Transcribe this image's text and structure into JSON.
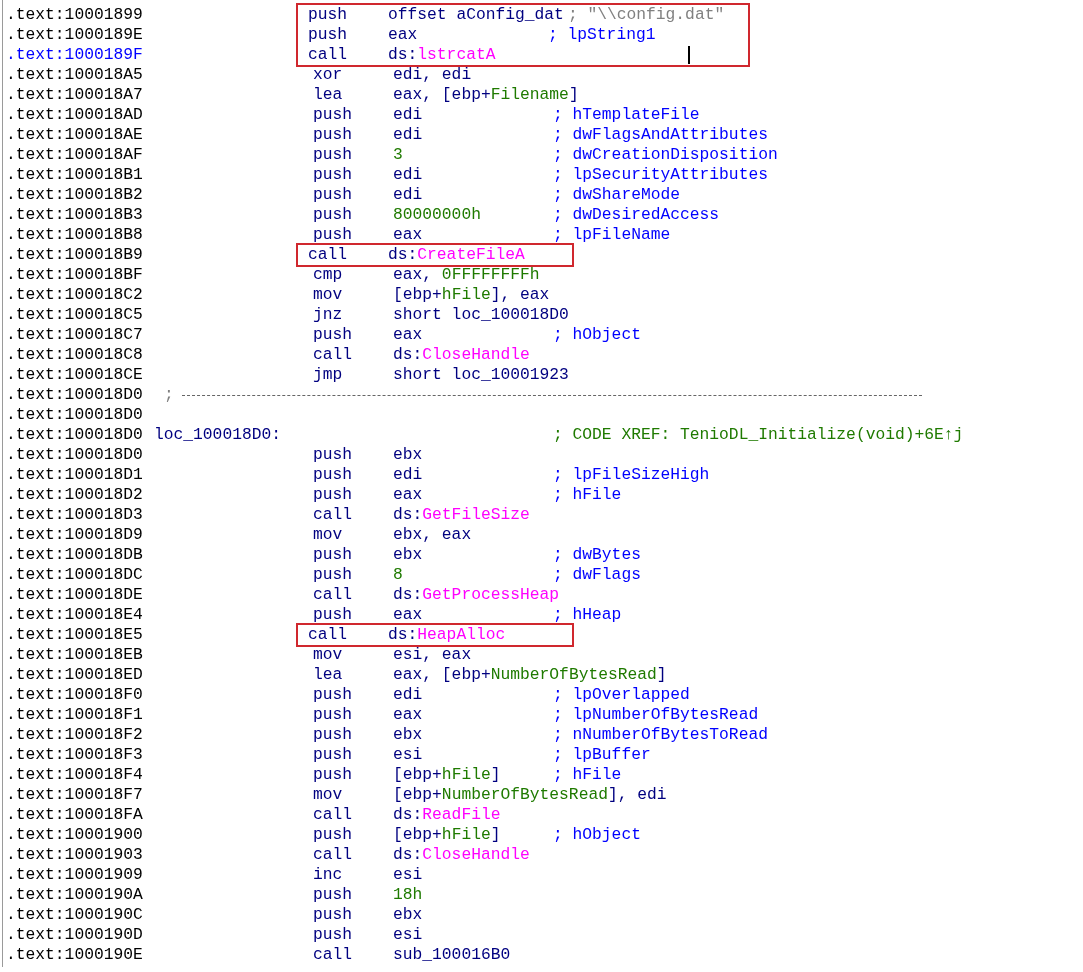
{
  "blocks": [
    {
      "kind": "highlight",
      "lines": [
        {
          "addr": ".text:10001899",
          "kind": "instr",
          "selected": false,
          "mnemonic": "push",
          "operands": [
            {
              "text": "offset aConfig_dat",
              "kind": "op"
            }
          ],
          "comment": {
            "text": "; \"\\\\config.dat\"",
            "kind": "str"
          }
        },
        {
          "addr": ".text:1000189E",
          "kind": "instr",
          "selected": false,
          "mnemonic": "push",
          "operands": [
            {
              "text": "eax",
              "kind": "op"
            }
          ],
          "comment": {
            "text": "; lpString1",
            "kind": "arg"
          }
        },
        {
          "addr": ".text:1000189F",
          "kind": "instr",
          "selected": true,
          "text_cursor": true,
          "mnemonic": "call",
          "operands": [
            {
              "text": "ds:",
              "kind": "op"
            },
            {
              "text": "lstrcatA",
              "kind": "api"
            }
          ]
        }
      ]
    },
    {
      "kind": "plain",
      "lines": [
        {
          "addr": ".text:100018A5",
          "kind": "instr",
          "selected": false,
          "mnemonic": "xor",
          "operands": [
            {
              "text": "edi, edi",
              "kind": "op"
            }
          ]
        },
        {
          "addr": ".text:100018A7",
          "kind": "instr",
          "selected": false,
          "mnemonic": "lea",
          "operands": [
            {
              "text": "eax, [ebp+",
              "kind": "op"
            },
            {
              "text": "Filename",
              "kind": "name"
            },
            {
              "text": "]",
              "kind": "op"
            }
          ]
        },
        {
          "addr": ".text:100018AD",
          "kind": "instr",
          "selected": false,
          "mnemonic": "push",
          "operands": [
            {
              "text": "edi",
              "kind": "op"
            }
          ],
          "comment": {
            "text": "; hTemplateFile",
            "kind": "arg"
          }
        },
        {
          "addr": ".text:100018AE",
          "kind": "instr",
          "selected": false,
          "mnemonic": "push",
          "operands": [
            {
              "text": "edi",
              "kind": "op"
            }
          ],
          "comment": {
            "text": "; dwFlagsAndAttributes",
            "kind": "arg"
          }
        },
        {
          "addr": ".text:100018AF",
          "kind": "instr",
          "selected": false,
          "mnemonic": "push",
          "operands": [
            {
              "text": "3",
              "kind": "num"
            }
          ],
          "comment": {
            "text": "; dwCreationDisposition",
            "kind": "arg"
          }
        },
        {
          "addr": ".text:100018B1",
          "kind": "instr",
          "selected": false,
          "mnemonic": "push",
          "operands": [
            {
              "text": "edi",
              "kind": "op"
            }
          ],
          "comment": {
            "text": "; lpSecurityAttributes",
            "kind": "arg"
          }
        },
        {
          "addr": ".text:100018B2",
          "kind": "instr",
          "selected": false,
          "mnemonic": "push",
          "operands": [
            {
              "text": "edi",
              "kind": "op"
            }
          ],
          "comment": {
            "text": "; dwShareMode",
            "kind": "arg"
          }
        },
        {
          "addr": ".text:100018B3",
          "kind": "instr",
          "selected": false,
          "mnemonic": "push",
          "operands": [
            {
              "text": "80000000h",
              "kind": "num"
            }
          ],
          "comment": {
            "text": "; dwDesiredAccess",
            "kind": "arg"
          }
        },
        {
          "addr": ".text:100018B8",
          "kind": "instr",
          "selected": false,
          "mnemonic": "push",
          "operands": [
            {
              "text": "eax",
              "kind": "op"
            }
          ],
          "comment": {
            "text": "; lpFileName",
            "kind": "arg"
          }
        }
      ]
    },
    {
      "kind": "highlight",
      "lines": [
        {
          "addr": ".text:100018B9",
          "kind": "instr",
          "selected": false,
          "mnemonic": "call",
          "operands": [
            {
              "text": "ds:",
              "kind": "op"
            },
            {
              "text": "CreateFileA",
              "kind": "api"
            }
          ]
        }
      ]
    },
    {
      "kind": "plain",
      "lines": [
        {
          "addr": ".text:100018BF",
          "kind": "instr",
          "selected": false,
          "mnemonic": "cmp",
          "operands": [
            {
              "text": "eax, ",
              "kind": "op"
            },
            {
              "text": "0FFFFFFFFh",
              "kind": "num"
            }
          ]
        },
        {
          "addr": ".text:100018C2",
          "kind": "instr",
          "selected": false,
          "mnemonic": "mov",
          "operands": [
            {
              "text": "[ebp+",
              "kind": "op"
            },
            {
              "text": "hFile",
              "kind": "name"
            },
            {
              "text": "], eax",
              "kind": "op"
            }
          ]
        },
        {
          "addr": ".text:100018C5",
          "kind": "instr",
          "selected": false,
          "mnemonic": "jnz",
          "operands": [
            {
              "text": "short loc_100018D0",
              "kind": "op"
            }
          ]
        },
        {
          "addr": ".text:100018C7",
          "kind": "instr",
          "selected": false,
          "mnemonic": "push",
          "operands": [
            {
              "text": "eax",
              "kind": "op"
            }
          ],
          "comment": {
            "text": "; hObject",
            "kind": "arg"
          }
        },
        {
          "addr": ".text:100018C8",
          "kind": "instr",
          "selected": false,
          "mnemonic": "call",
          "operands": [
            {
              "text": "ds:",
              "kind": "op"
            },
            {
              "text": "CloseHandle",
              "kind": "api"
            }
          ]
        },
        {
          "addr": ".text:100018CE",
          "kind": "instr",
          "selected": false,
          "mnemonic": "jmp",
          "operands": [
            {
              "text": "short loc_10001923",
              "kind": "op"
            }
          ]
        },
        {
          "addr": ".text:100018D0",
          "kind": "separator",
          "selected": false,
          "comment": {
            "text": ";",
            "kind": "sep"
          }
        },
        {
          "addr": ".text:100018D0",
          "kind": "blank",
          "selected": false
        },
        {
          "addr": ".text:100018D0",
          "kind": "label",
          "selected": false,
          "label": "loc_100018D0:",
          "comment": {
            "text": "; CODE XREF: TenioDL_Initialize(void)+6E↑j",
            "kind": "xref"
          }
        },
        {
          "addr": ".text:100018D0",
          "kind": "instr",
          "selected": false,
          "mnemonic": "push",
          "operands": [
            {
              "text": "ebx",
              "kind": "op"
            }
          ]
        },
        {
          "addr": ".text:100018D1",
          "kind": "instr",
          "selected": false,
          "mnemonic": "push",
          "operands": [
            {
              "text": "edi",
              "kind": "op"
            }
          ],
          "comment": {
            "text": "; lpFileSizeHigh",
            "kind": "arg"
          }
        },
        {
          "addr": ".text:100018D2",
          "kind": "instr",
          "selected": false,
          "mnemonic": "push",
          "operands": [
            {
              "text": "eax",
              "kind": "op"
            }
          ],
          "comment": {
            "text": "; hFile",
            "kind": "arg"
          }
        },
        {
          "addr": ".text:100018D3",
          "kind": "instr",
          "selected": false,
          "mnemonic": "call",
          "operands": [
            {
              "text": "ds:",
              "kind": "op"
            },
            {
              "text": "GetFileSize",
              "kind": "api"
            }
          ]
        },
        {
          "addr": ".text:100018D9",
          "kind": "instr",
          "selected": false,
          "mnemonic": "mov",
          "operands": [
            {
              "text": "ebx, eax",
              "kind": "op"
            }
          ]
        },
        {
          "addr": ".text:100018DB",
          "kind": "instr",
          "selected": false,
          "mnemonic": "push",
          "operands": [
            {
              "text": "ebx",
              "kind": "op"
            }
          ],
          "comment": {
            "text": "; dwBytes",
            "kind": "arg"
          }
        },
        {
          "addr": ".text:100018DC",
          "kind": "instr",
          "selected": false,
          "mnemonic": "push",
          "operands": [
            {
              "text": "8",
              "kind": "num"
            }
          ],
          "comment": {
            "text": "; dwFlags",
            "kind": "arg"
          }
        },
        {
          "addr": ".text:100018DE",
          "kind": "instr",
          "selected": false,
          "mnemonic": "call",
          "operands": [
            {
              "text": "ds:",
              "kind": "op"
            },
            {
              "text": "GetProcessHeap",
              "kind": "api"
            }
          ]
        },
        {
          "addr": ".text:100018E4",
          "kind": "instr",
          "selected": false,
          "mnemonic": "push",
          "operands": [
            {
              "text": "eax",
              "kind": "op"
            }
          ],
          "comment": {
            "text": "; hHeap",
            "kind": "arg"
          }
        }
      ]
    },
    {
      "kind": "highlight",
      "lines": [
        {
          "addr": ".text:100018E5",
          "kind": "instr",
          "selected": false,
          "mnemonic": "call",
          "operands": [
            {
              "text": "ds:",
              "kind": "op"
            },
            {
              "text": "HeapAlloc",
              "kind": "api"
            }
          ]
        }
      ]
    },
    {
      "kind": "plain",
      "lines": [
        {
          "addr": ".text:100018EB",
          "kind": "instr",
          "selected": false,
          "mnemonic": "mov",
          "operands": [
            {
              "text": "esi, eax",
              "kind": "op"
            }
          ]
        },
        {
          "addr": ".text:100018ED",
          "kind": "instr",
          "selected": false,
          "mnemonic": "lea",
          "operands": [
            {
              "text": "eax, [ebp+",
              "kind": "op"
            },
            {
              "text": "NumberOfBytesRead",
              "kind": "name"
            },
            {
              "text": "]",
              "kind": "op"
            }
          ]
        },
        {
          "addr": ".text:100018F0",
          "kind": "instr",
          "selected": false,
          "mnemonic": "push",
          "operands": [
            {
              "text": "edi",
              "kind": "op"
            }
          ],
          "comment": {
            "text": "; lpOverlapped",
            "kind": "arg"
          }
        },
        {
          "addr": ".text:100018F1",
          "kind": "instr",
          "selected": false,
          "mnemonic": "push",
          "operands": [
            {
              "text": "eax",
              "kind": "op"
            }
          ],
          "comment": {
            "text": "; lpNumberOfBytesRead",
            "kind": "arg"
          }
        },
        {
          "addr": ".text:100018F2",
          "kind": "instr",
          "selected": false,
          "mnemonic": "push",
          "operands": [
            {
              "text": "ebx",
              "kind": "op"
            }
          ],
          "comment": {
            "text": "; nNumberOfBytesToRead",
            "kind": "arg"
          }
        },
        {
          "addr": ".text:100018F3",
          "kind": "instr",
          "selected": false,
          "mnemonic": "push",
          "operands": [
            {
              "text": "esi",
              "kind": "op"
            }
          ],
          "comment": {
            "text": "; lpBuffer",
            "kind": "arg"
          }
        },
        {
          "addr": ".text:100018F4",
          "kind": "instr",
          "selected": false,
          "mnemonic": "push",
          "operands": [
            {
              "text": "[ebp+",
              "kind": "op"
            },
            {
              "text": "hFile",
              "kind": "name"
            },
            {
              "text": "]",
              "kind": "op"
            }
          ],
          "comment": {
            "text": "; hFile",
            "kind": "arg"
          }
        },
        {
          "addr": ".text:100018F7",
          "kind": "instr",
          "selected": false,
          "mnemonic": "mov",
          "operands": [
            {
              "text": "[ebp+",
              "kind": "op"
            },
            {
              "text": "NumberOfBytesRead",
              "kind": "name"
            },
            {
              "text": "], edi",
              "kind": "op"
            }
          ]
        },
        {
          "addr": ".text:100018FA",
          "kind": "instr",
          "selected": false,
          "mnemonic": "call",
          "operands": [
            {
              "text": "ds:",
              "kind": "op"
            },
            {
              "text": "ReadFile",
              "kind": "api"
            }
          ]
        },
        {
          "addr": ".text:10001900",
          "kind": "instr",
          "selected": false,
          "mnemonic": "push",
          "operands": [
            {
              "text": "[ebp+",
              "kind": "op"
            },
            {
              "text": "hFile",
              "kind": "name"
            },
            {
              "text": "]",
              "kind": "op"
            }
          ],
          "comment": {
            "text": "; hObject",
            "kind": "arg"
          }
        },
        {
          "addr": ".text:10001903",
          "kind": "instr",
          "selected": false,
          "mnemonic": "call",
          "operands": [
            {
              "text": "ds:",
              "kind": "op"
            },
            {
              "text": "CloseHandle",
              "kind": "api"
            }
          ]
        },
        {
          "addr": ".text:10001909",
          "kind": "instr",
          "selected": false,
          "mnemonic": "inc",
          "operands": [
            {
              "text": "esi",
              "kind": "op"
            }
          ]
        },
        {
          "addr": ".text:1000190A",
          "kind": "instr",
          "selected": false,
          "mnemonic": "push",
          "operands": [
            {
              "text": "18h",
              "kind": "num"
            }
          ]
        },
        {
          "addr": ".text:1000190C",
          "kind": "instr",
          "selected": false,
          "mnemonic": "push",
          "operands": [
            {
              "text": "ebx",
              "kind": "op"
            }
          ]
        },
        {
          "addr": ".text:1000190D",
          "kind": "instr",
          "selected": false,
          "mnemonic": "push",
          "operands": [
            {
              "text": "esi",
              "kind": "op"
            }
          ]
        },
        {
          "addr": ".text:1000190E",
          "kind": "instr",
          "selected": false,
          "mnemonic": "call",
          "operands": [
            {
              "text": "sub_100016B0",
              "kind": "op"
            }
          ]
        }
      ]
    }
  ]
}
